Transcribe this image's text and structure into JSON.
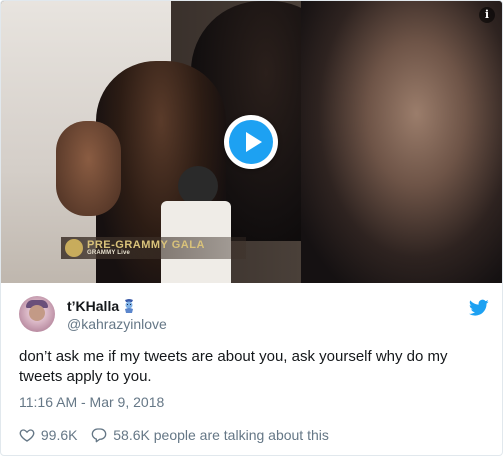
{
  "media": {
    "lower_third_line1": "PRE-GRAMMY GALA",
    "lower_third_line2": "GRAMMY Live",
    "info_icon": "i"
  },
  "tweet": {
    "display_name": "t’KHalla",
    "handle": "@kahrazyinlove",
    "text": "don’t ask me if my tweets are about you, ask yourself why do my tweets apply to you.",
    "timestamp": "11:16 AM - Mar 9, 2018",
    "likes": "99.6K",
    "talking": "58.6K people are talking about this"
  },
  "icons": {
    "play": "play-icon",
    "info": "info-icon",
    "bird": "twitter-bird-icon",
    "heart": "heart-icon",
    "reply": "reply-icon",
    "emoji": "genie-emoji-icon"
  },
  "colors": {
    "accent": "#1da1f2",
    "text": "#14171a",
    "muted": "#657786",
    "border": "#e1e8ed"
  }
}
